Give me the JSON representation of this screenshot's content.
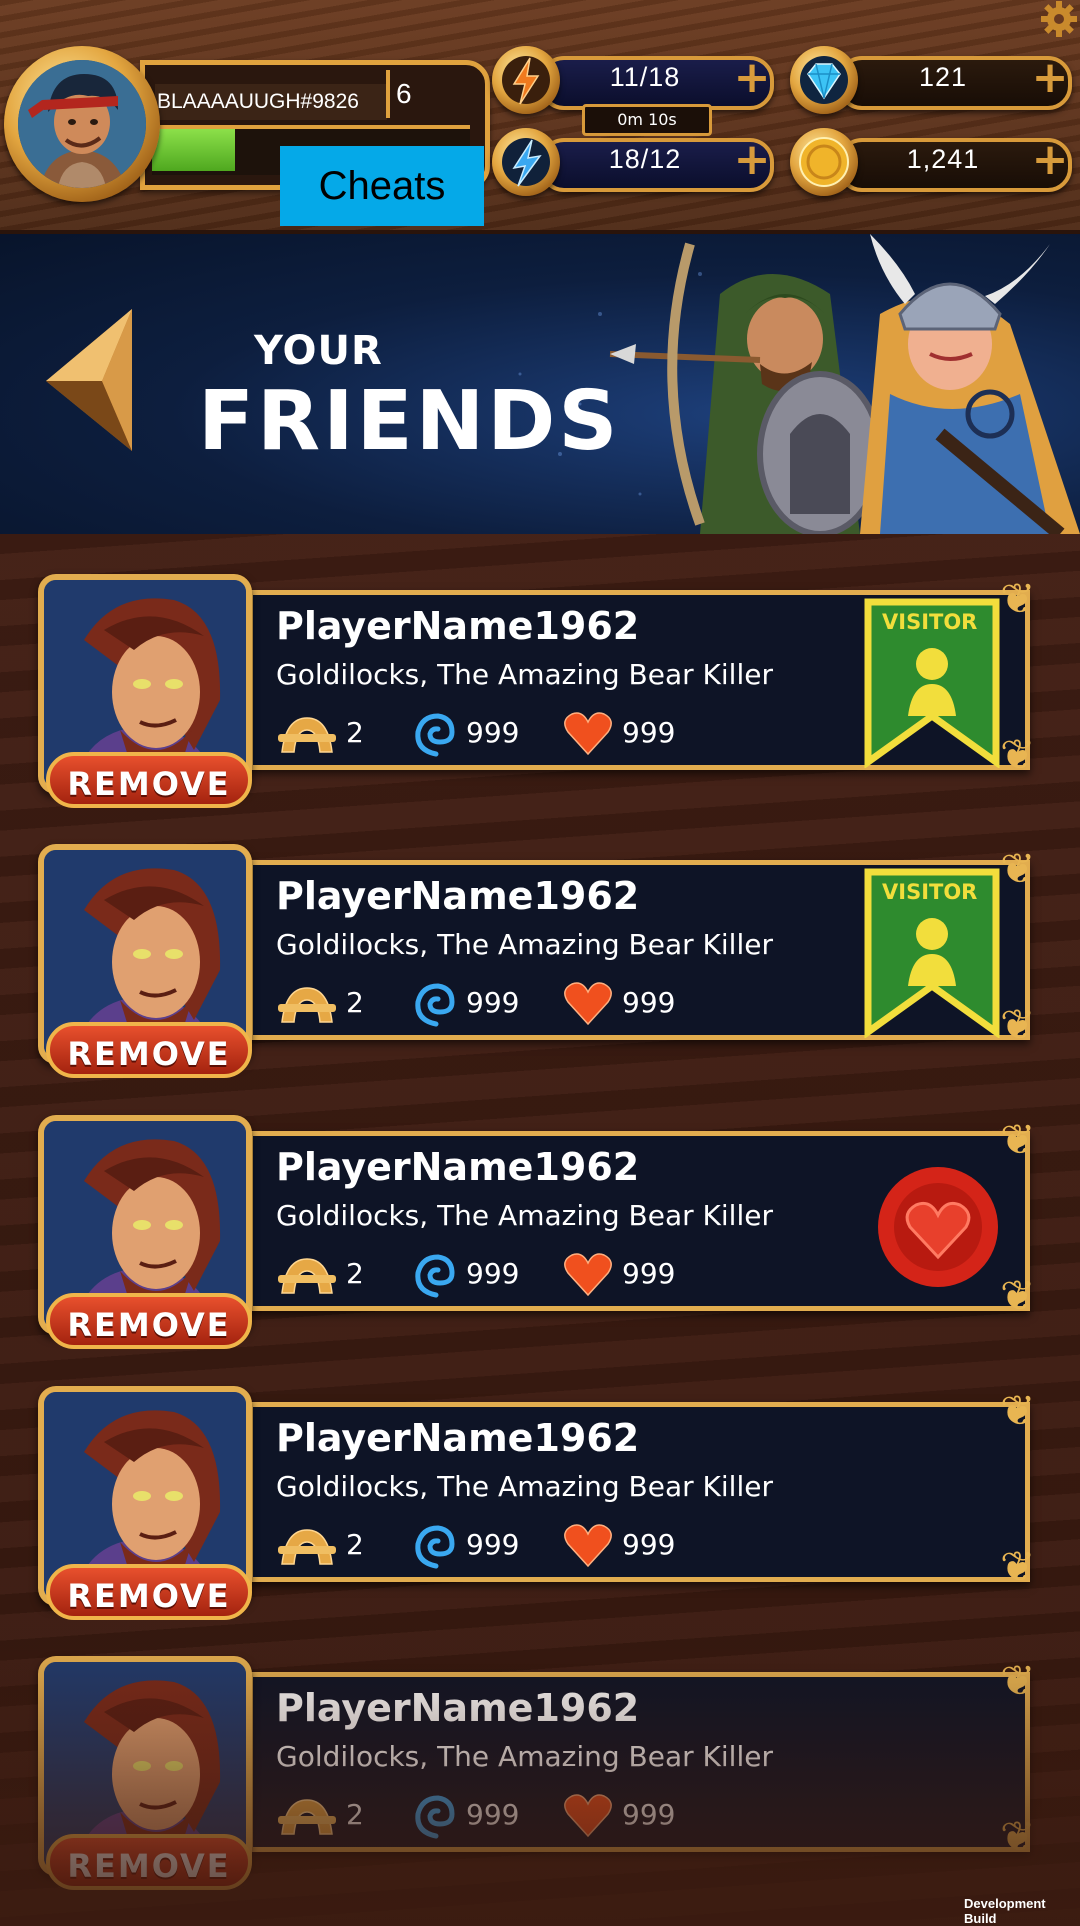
{
  "hud": {
    "player_tag": "BLAAAAUUGH#9826",
    "level": "6",
    "xp_progress": 0.26,
    "cheats_label": "Cheats",
    "energy": {
      "value": "11/18",
      "icon": "lightning-bolt-orange-icon"
    },
    "energy_timer": "0m 10s",
    "stamina": {
      "value": "18/12",
      "icon": "lightning-bolt-blue-icon"
    },
    "gems": {
      "value": "121",
      "icon": "gem-icon"
    },
    "coins": {
      "value": "1,241",
      "icon": "coin-icon"
    },
    "plus_label": "+",
    "settings_icon": "gear-icon"
  },
  "banner": {
    "line1": "YOUR",
    "line2": "FRIENDS",
    "back_icon": "back-arrow-icon"
  },
  "friends": [
    {
      "name": "PlayerName1962",
      "title": "Goldilocks, The Amazing Bear Killer",
      "rank": "2",
      "energy": "999",
      "hearts": "999",
      "badge": "visitor",
      "badge_label": "VISITOR",
      "action": "REMOVE"
    },
    {
      "name": "PlayerName1962",
      "title": "Goldilocks, The Amazing Bear Killer",
      "rank": "2",
      "energy": "999",
      "hearts": "999",
      "badge": "visitor",
      "badge_label": "VISITOR",
      "action": "REMOVE"
    },
    {
      "name": "PlayerName1962",
      "title": "Goldilocks, The Amazing Bear Killer",
      "rank": "2",
      "energy": "999",
      "hearts": "999",
      "badge": "heart-seal",
      "badge_label": "",
      "action": "REMOVE"
    },
    {
      "name": "PlayerName1962",
      "title": "Goldilocks, The Amazing Bear Killer",
      "rank": "2",
      "energy": "999",
      "hearts": "999",
      "badge": "none",
      "badge_label": "",
      "action": "REMOVE"
    },
    {
      "name": "PlayerName1962",
      "title": "Goldilocks, The Amazing Bear Killer",
      "rank": "2",
      "energy": "999",
      "hearts": "999",
      "badge": "none",
      "badge_label": "",
      "action": "REMOVE"
    }
  ],
  "footer": {
    "dev_build": "Development Build"
  },
  "colors": {
    "gold": "#e2ad4f",
    "panel": "#0e1426",
    "remove_red": "#d8401f",
    "cheats_blue": "#05a9e8",
    "visitor_green": "#2e8b2e",
    "visitor_yellow": "#f2de3c"
  }
}
